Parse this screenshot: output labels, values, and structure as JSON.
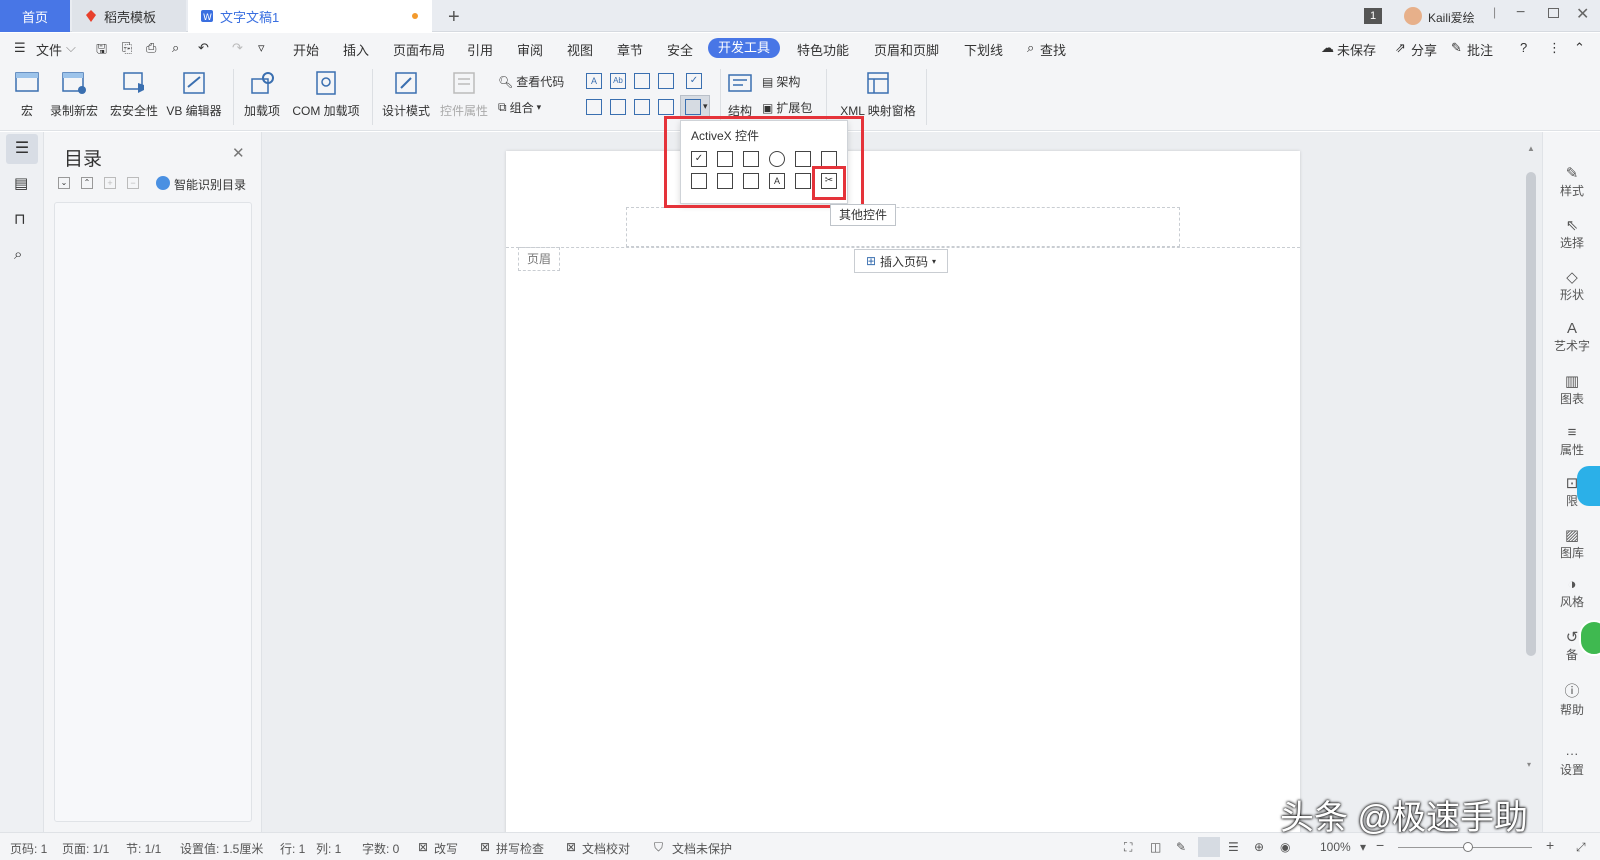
{
  "tabs": {
    "home": "首页",
    "template": "稻壳模板",
    "doc": "文字文稿1",
    "user": "Kaili爱绘",
    "badge": "1"
  },
  "menu": {
    "file": "文件",
    "items": [
      "开始",
      "插入",
      "页面布局",
      "引用",
      "审阅",
      "视图",
      "章节",
      "安全",
      "开发工具",
      "特色功能",
      "页眉和页脚",
      "下划线"
    ],
    "search": "查找",
    "unsaved": "未保存",
    "share": "分享",
    "comment": "批注"
  },
  "ribbon": {
    "macro": "宏",
    "record": "录制新宏",
    "security": "宏安全性",
    "vb": "VB 编辑器",
    "addins": "加载项",
    "com": "COM 加载项",
    "design": "设计模式",
    "props": "控件属性",
    "viewcode": "查看代码",
    "group": "组合",
    "structure": "结构",
    "schema": "架构",
    "expansion": "扩展包",
    "xml": "XML 映射窗格"
  },
  "popup": {
    "title": "ActiveX 控件",
    "tooltip": "其他控件"
  },
  "toc": {
    "title": "目录",
    "smart": "智能识别目录"
  },
  "doc": {
    "header_label": "页眉",
    "insert_page": "插入页码"
  },
  "rightrail": [
    "样式",
    "选择",
    "形状",
    "艺术字",
    "图表",
    "属性",
    "限",
    "图库",
    "风格",
    "备",
    "帮助",
    "设置"
  ],
  "status": {
    "page": "页码: 1",
    "pages": "页面: 1/1",
    "section": "节: 1/1",
    "setting": "设置值: 1.5厘米",
    "row": "行: 1",
    "col": "列: 1",
    "words": "字数: 0",
    "revise": "改写",
    "spell": "拼写检查",
    "proof": "文档校对",
    "protect": "文档未保护",
    "zoom": "100%"
  },
  "watermark": "头条 @极速手助",
  "colors": {
    "accent": "#4876e6",
    "highlight": "#e5333a"
  }
}
